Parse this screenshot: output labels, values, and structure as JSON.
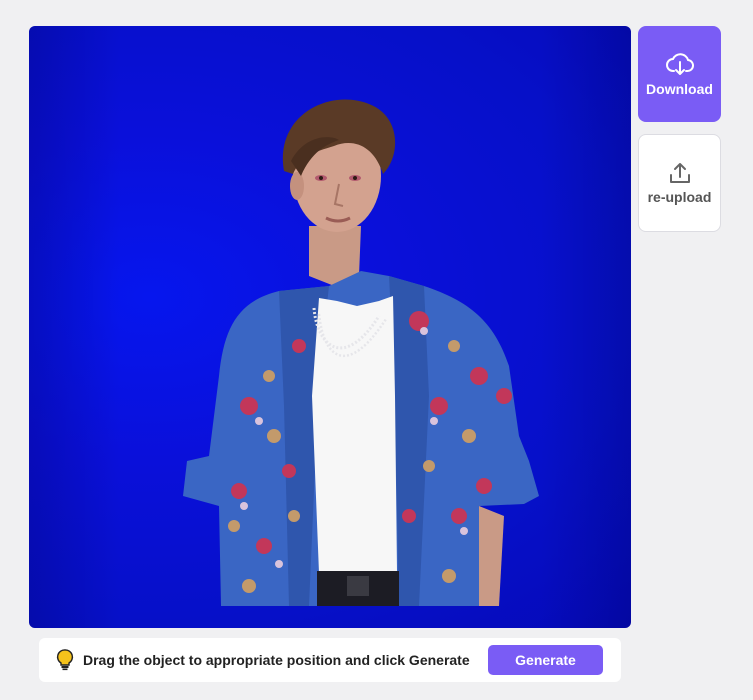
{
  "actions": {
    "download_label": "Download",
    "reupload_label": "re-upload"
  },
  "footer": {
    "hint_text": "Drag the object to appropriate position and click Generate",
    "generate_label": "Generate"
  },
  "colors": {
    "accent": "#7a5cf5",
    "canvas_background": "#0a10d6"
  },
  "icons": {
    "download": "cloud-download-icon",
    "reupload": "upload-icon",
    "hint": "lightbulb-icon"
  }
}
